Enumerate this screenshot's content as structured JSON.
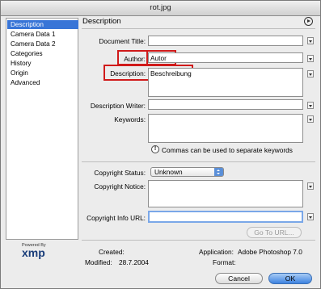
{
  "window": {
    "title": "rot.jpg"
  },
  "sidebar": {
    "items": [
      {
        "label": "Description",
        "active": true
      },
      {
        "label": "Camera Data 1",
        "active": false
      },
      {
        "label": "Camera Data 2",
        "active": false
      },
      {
        "label": "Categories",
        "active": false
      },
      {
        "label": "History",
        "active": false
      },
      {
        "label": "Origin",
        "active": false
      },
      {
        "label": "Advanced",
        "active": false
      }
    ]
  },
  "panel": {
    "title": "Description",
    "fields": {
      "document_title": {
        "label": "Document Title:",
        "value": ""
      },
      "author": {
        "label": "Author:",
        "value": "Autor"
      },
      "description": {
        "label": "Description:",
        "value": "Beschreibung"
      },
      "description_writer": {
        "label": "Description Writer:",
        "value": ""
      },
      "keywords": {
        "label": "Keywords:",
        "value": ""
      },
      "keywords_hint": "Commas can be used to separate keywords",
      "copyright_status": {
        "label": "Copyright Status:",
        "value": "Unknown"
      },
      "copyright_notice": {
        "label": "Copyright Notice:",
        "value": ""
      },
      "copyright_url": {
        "label": "Copyright Info URL:",
        "value": ""
      },
      "go_to_url": "Go To URL..."
    }
  },
  "footer": {
    "created_label": "Created:",
    "created_value": "",
    "modified_label": "Modified:",
    "modified_value": "28.7.2004",
    "application_label": "Application:",
    "application_value": "Adobe Photoshop 7.0",
    "format_label": "Format:",
    "format_value": "",
    "powered_by": "Powered By",
    "logo_text": "xmp"
  },
  "buttons": {
    "cancel": "Cancel",
    "ok": "OK"
  },
  "colors": {
    "accent": "#3875d7",
    "highlight_box": "#d01a1a"
  }
}
